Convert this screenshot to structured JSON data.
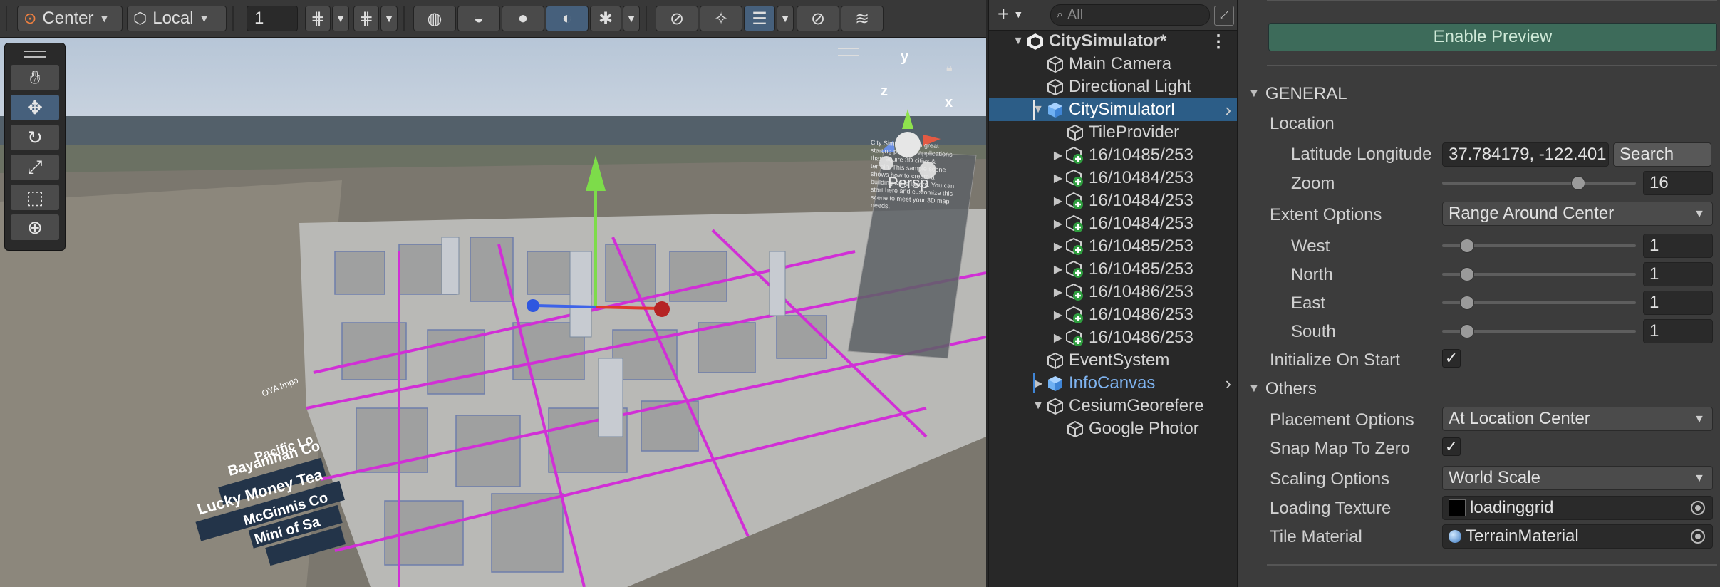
{
  "scene_toolbar": {
    "pivot_mode": "Center",
    "pivot_rotation": "Local",
    "grid_value": "1"
  },
  "viewport": {
    "camera_label": "Persp",
    "gizmo_axes": {
      "x": "x",
      "y": "y",
      "z": "z"
    },
    "info_panel_text": "City Simulator is a great starting point for applications that require 3D cities & terrain. This sample scene shows how to create a building & tile layers. You can start here and customize this scene to meet your 3D map needs.",
    "map_labels": [
      "Bayanihan Co",
      "Lucky Money Tea",
      "McGinnis Co",
      "Mini of Sa",
      "Pacific Lo",
      "OYA Impo"
    ]
  },
  "tools": [
    "hand-tool",
    "move-tool",
    "rotate-tool",
    "scale-tool",
    "rect-tool",
    "transform-tool"
  ],
  "hierarchy": {
    "search_placeholder": "All",
    "items": [
      {
        "label": "CitySimulator*",
        "depth": 0,
        "expanded": true,
        "bold": true,
        "icon": "unity-scene-icon"
      },
      {
        "label": "Main Camera",
        "depth": 1,
        "icon": "gameobject-cube-icon"
      },
      {
        "label": "Directional Light",
        "depth": 1,
        "icon": "gameobject-cube-icon"
      },
      {
        "label": "CitySimulatorI",
        "depth": 1,
        "expanded": true,
        "selected": true,
        "icon": "prefab-cube-icon"
      },
      {
        "label": "TileProvider",
        "depth": 2,
        "icon": "gameobject-cube-icon"
      },
      {
        "label": "16/10485/253",
        "depth": 2,
        "collapsed": true,
        "icon": "added-gameobject-icon"
      },
      {
        "label": "16/10484/253",
        "depth": 2,
        "collapsed": true,
        "icon": "added-gameobject-icon"
      },
      {
        "label": "16/10484/253",
        "depth": 2,
        "collapsed": true,
        "icon": "added-gameobject-icon"
      },
      {
        "label": "16/10484/253",
        "depth": 2,
        "collapsed": true,
        "icon": "added-gameobject-icon"
      },
      {
        "label": "16/10485/253",
        "depth": 2,
        "collapsed": true,
        "icon": "added-gameobject-icon"
      },
      {
        "label": "16/10485/253",
        "depth": 2,
        "collapsed": true,
        "icon": "added-gameobject-icon"
      },
      {
        "label": "16/10486/253",
        "depth": 2,
        "collapsed": true,
        "icon": "added-gameobject-icon"
      },
      {
        "label": "16/10486/253",
        "depth": 2,
        "collapsed": true,
        "icon": "added-gameobject-icon"
      },
      {
        "label": "16/10486/253",
        "depth": 2,
        "collapsed": true,
        "icon": "added-gameobject-icon"
      },
      {
        "label": "EventSystem",
        "depth": 1,
        "icon": "gameobject-cube-icon"
      },
      {
        "label": "InfoCanvas",
        "depth": 1,
        "collapsed": true,
        "prefab": true,
        "icon": "prefab-cube-icon"
      },
      {
        "label": "CesiumGeorefere",
        "depth": 1,
        "expanded": true,
        "icon": "gameobject-cube-icon"
      },
      {
        "label": "Google Photor",
        "depth": 2,
        "icon": "gameobject-cube-icon"
      }
    ]
  },
  "inspector": {
    "enable_preview_label": "Enable Preview",
    "general_header": "GENERAL",
    "location_label": "Location",
    "latlon_label": "Latitude Longitude",
    "latlon_value": "37.784179, -122.401",
    "search_button": "Search",
    "zoom_label": "Zoom",
    "zoom_value": "16",
    "zoom_fraction": 0.7,
    "extent_options_label": "Extent Options",
    "extent_options_value": "Range Around Center",
    "west_label": "West",
    "west_value": "1",
    "north_label": "North",
    "north_value": "1",
    "east_label": "East",
    "east_value": "1",
    "south_label": "South",
    "south_value": "1",
    "initialize_label": "Initialize On Start",
    "initialize_checked": true,
    "others_header": "Others",
    "placement_label": "Placement Options",
    "placement_value": "At Location Center",
    "snap_label": "Snap Map To Zero",
    "snap_checked": true,
    "scaling_label": "Scaling Options",
    "scaling_value": "World Scale",
    "loading_texture_label": "Loading Texture",
    "loading_texture_value": "loadinggrid",
    "tile_material_label": "Tile Material",
    "tile_material_value": "TerrainMaterial"
  },
  "colors": {
    "accent_selected": "#2c5d87",
    "preview_button": "#3d6b5a",
    "road_magenta": "#d12fd6",
    "prefab_blue": "#7fb3ef"
  }
}
